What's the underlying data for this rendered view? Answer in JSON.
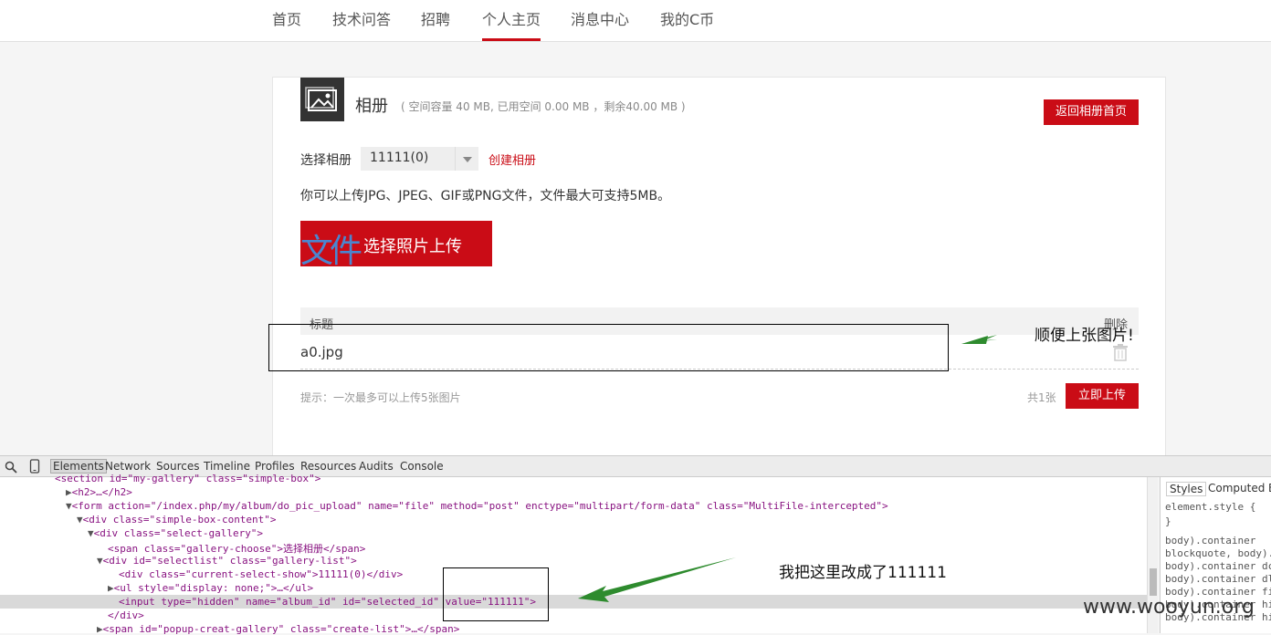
{
  "nav": {
    "items": [
      "首页",
      "技术问答",
      "招聘",
      "个人主页",
      "消息中心",
      "我的C币"
    ],
    "active": "个人主页"
  },
  "album": {
    "title": "相册",
    "note": "( 空间容量 40 MB, 已用空间 0.00 MB ，剩余40.00 MB )",
    "back_button": "返回相册首页",
    "select_label": "选择相册",
    "select_value": "11111(0)",
    "create_link": "创建相册",
    "description": "你可以上传JPG、JPEG、GIF或PNG文件，文件最大可支持5MB。",
    "upload_glyph": "文件",
    "upload_button": "选择照片上传",
    "table_col_title": "标题",
    "table_col_delete": "删除",
    "file_name": "a0.jpg",
    "hint": "提示：一次最多可以上传5张图片",
    "count": "共1张",
    "submit_button": "立即上传"
  },
  "annotations": {
    "top": "顺便上张图片!",
    "bottom": "我把这里改成了111111",
    "watermark": "www.wooyun.org"
  },
  "devtools": {
    "tabs": [
      "Elements",
      "Network",
      "Sources",
      "Timeline",
      "Profiles",
      "Resources",
      "Audits",
      "Console"
    ],
    "active_tab": "Elements",
    "side_tabs": [
      "Styles",
      "Computed",
      "E"
    ],
    "style_lines": [
      "element.style {",
      "}",
      "body).container",
      "blockquote, body).",
      "body).container dc",
      "body).container dl",
      "body).container fi",
      "body).container hi",
      "body).container hi"
    ],
    "lines": [
      "<section id=\"my-gallery\" class=\"simple-box\">",
      "<h2>…</h2>",
      "<form action=\"/index.php/my/album/do_pic_upload\" name=\"file\" method=\"post\" enctype=\"multipart/form-data\" class=\"MultiFile-intercepted\">",
      "<div class=\"simple-box-content\">",
      "<div class=\"select-gallery\">",
      "<span class=\"gallery-choose\">选择相册</span>",
      "<div id=\"selectlist\" class=\"gallery-list\">",
      "<div class=\"current-select-show\">11111(0)</div>",
      "<ul style=\"display: none;\">…</ul>",
      "<input type=\"hidden\" name=\"album_id\" id=\"selected_id\" value=\"111111\">",
      "</div>",
      "<span id=\"popup-creat-gallery\" class=\"create-list\">…</span>"
    ]
  }
}
